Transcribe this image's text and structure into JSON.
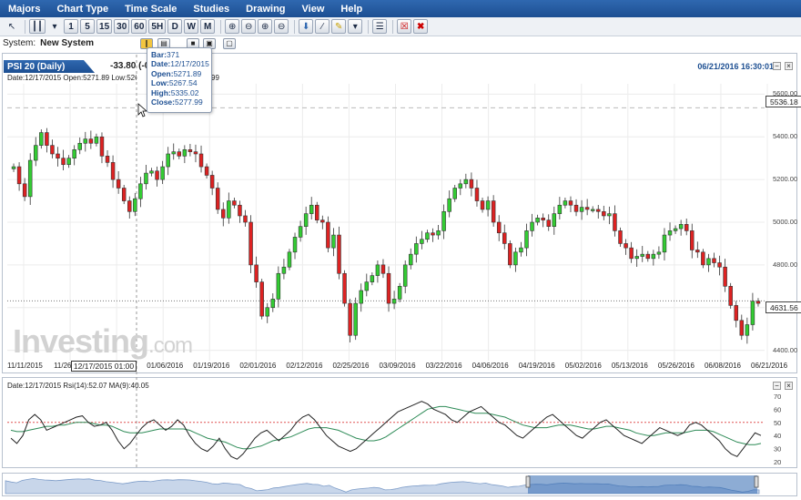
{
  "menu": [
    "Majors",
    "Chart Type",
    "Time Scale",
    "Studies",
    "Drawing",
    "View",
    "Help"
  ],
  "toolbar": {
    "timeframes": [
      "1",
      "5",
      "15",
      "30",
      "60",
      "5H",
      "D",
      "W",
      "M"
    ],
    "icons": [
      "cursor-icon",
      "candles-icon",
      "zoom-in-icon",
      "zoom-out-icon",
      "zoom-in-icon",
      "zoom-out-icon",
      "draw-icon",
      "line-icon",
      "pencil-icon",
      "dropdown-icon",
      "grid-icon",
      "delete-one-icon",
      "delete-all-icon"
    ]
  },
  "system": {
    "label": "System:",
    "value": "New System"
  },
  "symbol": {
    "name": "PSI 20 (Daily)",
    "change": "-33.80 (-0",
    "datetime": "06/21/2016 16:30:01"
  },
  "ohlc_line": {
    "text1": "Date:12/17/2015 Open:5271.89 Low:5267.54 Hig",
    "text2": "99"
  },
  "tooltip": {
    "bar": "371",
    "date": "12/17/2015",
    "open": "5271.89",
    "low": "5267.54",
    "high": "5335.02",
    "close": "5277.99",
    "k_bar": "Bar:",
    "k_date": "Date:",
    "k_open": "Open:",
    "k_low": "Low:",
    "k_high": "High:",
    "k_close": "Close:"
  },
  "rsi_line": "Date:12/17/2015 Rsi(14):52.07 MA(9):40.05",
  "watermark": {
    "brand": "Investing",
    "suffix": ".com"
  },
  "crosshair_date": "12/17/2015 01:00",
  "price_marks": {
    "last": "4631.56",
    "dashed": "5536.18"
  },
  "colors": {
    "up": "#33cc33",
    "down": "#dd2222",
    "rsi": "#222222",
    "ma": "#2e8b57",
    "ref": "#e05050",
    "nav": "#2f68b0"
  },
  "chart_data": [
    {
      "type": "candlestick",
      "x_labels": [
        "11/11/2015",
        "11/26/",
        "12/22/2015",
        "01/06/2016",
        "01/19/2016",
        "02/01/2016",
        "02/12/2016",
        "02/25/2016",
        "03/09/2016",
        "03/22/2016",
        "04/06/2016",
        "04/19/2016",
        "05/02/2016",
        "05/13/2016",
        "05/26/2016",
        "06/08/2016",
        "06/21/2016"
      ],
      "y_ticks": [
        4400,
        4600,
        4800,
        5000,
        5200,
        5400,
        5600
      ],
      "y_tick_labels": [
        "4400.00",
        "4600.00",
        "4800.00",
        "5000.00",
        "5200.00",
        "5400.00",
        "5600.00"
      ],
      "ylim": [
        4360,
        5640
      ],
      "close": [
        5260,
        5180,
        5120,
        5290,
        5360,
        5420,
        5360,
        5320,
        5300,
        5270,
        5300,
        5340,
        5370,
        5390,
        5370,
        5400,
        5310,
        5280,
        5200,
        5160,
        5100,
        5050,
        5110,
        5180,
        5230,
        5240,
        5200,
        5260,
        5320,
        5330,
        5310,
        5340,
        5330,
        5320,
        5260,
        5220,
        5160,
        5060,
        5020,
        5100,
        5080,
        5030,
        5000,
        4800,
        4720,
        4560,
        4600,
        4640,
        4760,
        4790,
        4860,
        4930,
        4980,
        5040,
        5080,
        5010,
        5000,
        4880,
        4940,
        4760,
        4620,
        4470,
        4620,
        4680,
        4720,
        4750,
        4800,
        4760,
        4620,
        4640,
        4700,
        4800,
        4850,
        4900,
        4920,
        4950,
        4940,
        4960,
        5050,
        5110,
        5160,
        5180,
        5200,
        5160,
        5100,
        5060,
        5100,
        5000,
        4950,
        4900,
        4800,
        4860,
        4880,
        4960,
        5000,
        5020,
        5010,
        4980,
        5040,
        5080,
        5100,
        5080,
        5050,
        5070,
        5060,
        5060,
        5050,
        5030,
        5040,
        4960,
        4900,
        4880,
        4830,
        4840,
        4850,
        4830,
        4850,
        4860,
        4940,
        4960,
        4970,
        4990,
        4960,
        4870,
        4860,
        4800,
        4830,
        4810,
        4790,
        4700,
        4610,
        4540,
        4470,
        4520,
        4630,
        4620
      ],
      "open": [
        5250,
        5260,
        5180,
        5120,
        5290,
        5360,
        5420,
        5360,
        5320,
        5300,
        5270,
        5300,
        5340,
        5370,
        5390,
        5370,
        5400,
        5310,
        5280,
        5200,
        5160,
        5100,
        5050,
        5110,
        5180,
        5230,
        5240,
        5200,
        5260,
        5320,
        5330,
        5310,
        5340,
        5330,
        5320,
        5260,
        5220,
        5160,
        5060,
        5020,
        5100,
        5080,
        5030,
        5000,
        4800,
        4720,
        4560,
        4600,
        4640,
        4760,
        4790,
        4860,
        4930,
        4980,
        5040,
        5080,
        5010,
        5000,
        4880,
        4940,
        4760,
        4620,
        4470,
        4620,
        4680,
        4720,
        4750,
        4800,
        4760,
        4620,
        4640,
        4700,
        4800,
        4850,
        4900,
        4920,
        4950,
        4940,
        4960,
        5050,
        5110,
        5160,
        5180,
        5200,
        5160,
        5100,
        5060,
        5100,
        5000,
        4950,
        4900,
        4800,
        4860,
        4880,
        4960,
        5000,
        5020,
        5010,
        4980,
        5040,
        5080,
        5100,
        5080,
        5050,
        5070,
        5060,
        5060,
        5050,
        5030,
        5040,
        4960,
        4900,
        4880,
        4830,
        4840,
        4850,
        4830,
        4850,
        4860,
        4940,
        4960,
        4970,
        4990,
        4960,
        4870,
        4860,
        4800,
        4830,
        4810,
        4790,
        4700,
        4610,
        4540,
        4470,
        4520,
        4630
      ]
    },
    {
      "type": "line",
      "name": "Rsi(14)",
      "y_ticks": [
        20,
        30,
        40,
        50,
        60,
        70
      ],
      "ylim": [
        18,
        72
      ],
      "reference_line": 50,
      "rsi": [
        38,
        34,
        40,
        52,
        56,
        52,
        44,
        46,
        48,
        50,
        52,
        54,
        55,
        50,
        47,
        48,
        50,
        44,
        36,
        30,
        34,
        40,
        46,
        50,
        52,
        48,
        44,
        47,
        52,
        48,
        40,
        34,
        30,
        28,
        32,
        38,
        30,
        24,
        22,
        26,
        32,
        38,
        42,
        44,
        40,
        36,
        40,
        44,
        50,
        54,
        56,
        52,
        46,
        40,
        36,
        32,
        30,
        28,
        30,
        34,
        38,
        42,
        46,
        50,
        54,
        58,
        60,
        62,
        64,
        66,
        64,
        60,
        58,
        56,
        52,
        50,
        54,
        58,
        60,
        62,
        58,
        54,
        50,
        48,
        44,
        40,
        38,
        42,
        46,
        50,
        54,
        56,
        52,
        48,
        44,
        40,
        38,
        42,
        46,
        50,
        52,
        48,
        44,
        40,
        38,
        36,
        34,
        38,
        42,
        46,
        44,
        42,
        40,
        42,
        48,
        50,
        48,
        44,
        40,
        36,
        30,
        26,
        24,
        30,
        36,
        42,
        40
      ],
      "ma": [
        44,
        43,
        43,
        44,
        45,
        46,
        47,
        47,
        48,
        48,
        49,
        50,
        50,
        50,
        49,
        48,
        48,
        47,
        45,
        43,
        42,
        42,
        42,
        43,
        44,
        45,
        45,
        45,
        45,
        45,
        44,
        42,
        40,
        38,
        37,
        36,
        35,
        33,
        31,
        30,
        30,
        31,
        32,
        34,
        36,
        37,
        38,
        39,
        41,
        43,
        45,
        46,
        46,
        46,
        45,
        44,
        42,
        40,
        38,
        37,
        36,
        36,
        37,
        39,
        42,
        45,
        48,
        51,
        54,
        57,
        60,
        61,
        62,
        62,
        61,
        60,
        59,
        58,
        57,
        57,
        57,
        56,
        55,
        54,
        52,
        50,
        48,
        47,
        46,
        46,
        46,
        47,
        48,
        48,
        48,
        47,
        46,
        45,
        45,
        46,
        47,
        47,
        46,
        45,
        44,
        42,
        41,
        40,
        40,
        41,
        42,
        42,
        42,
        42,
        43,
        44,
        44,
        44,
        43,
        41,
        39,
        37,
        35,
        34,
        33,
        33,
        34
      ]
    }
  ]
}
